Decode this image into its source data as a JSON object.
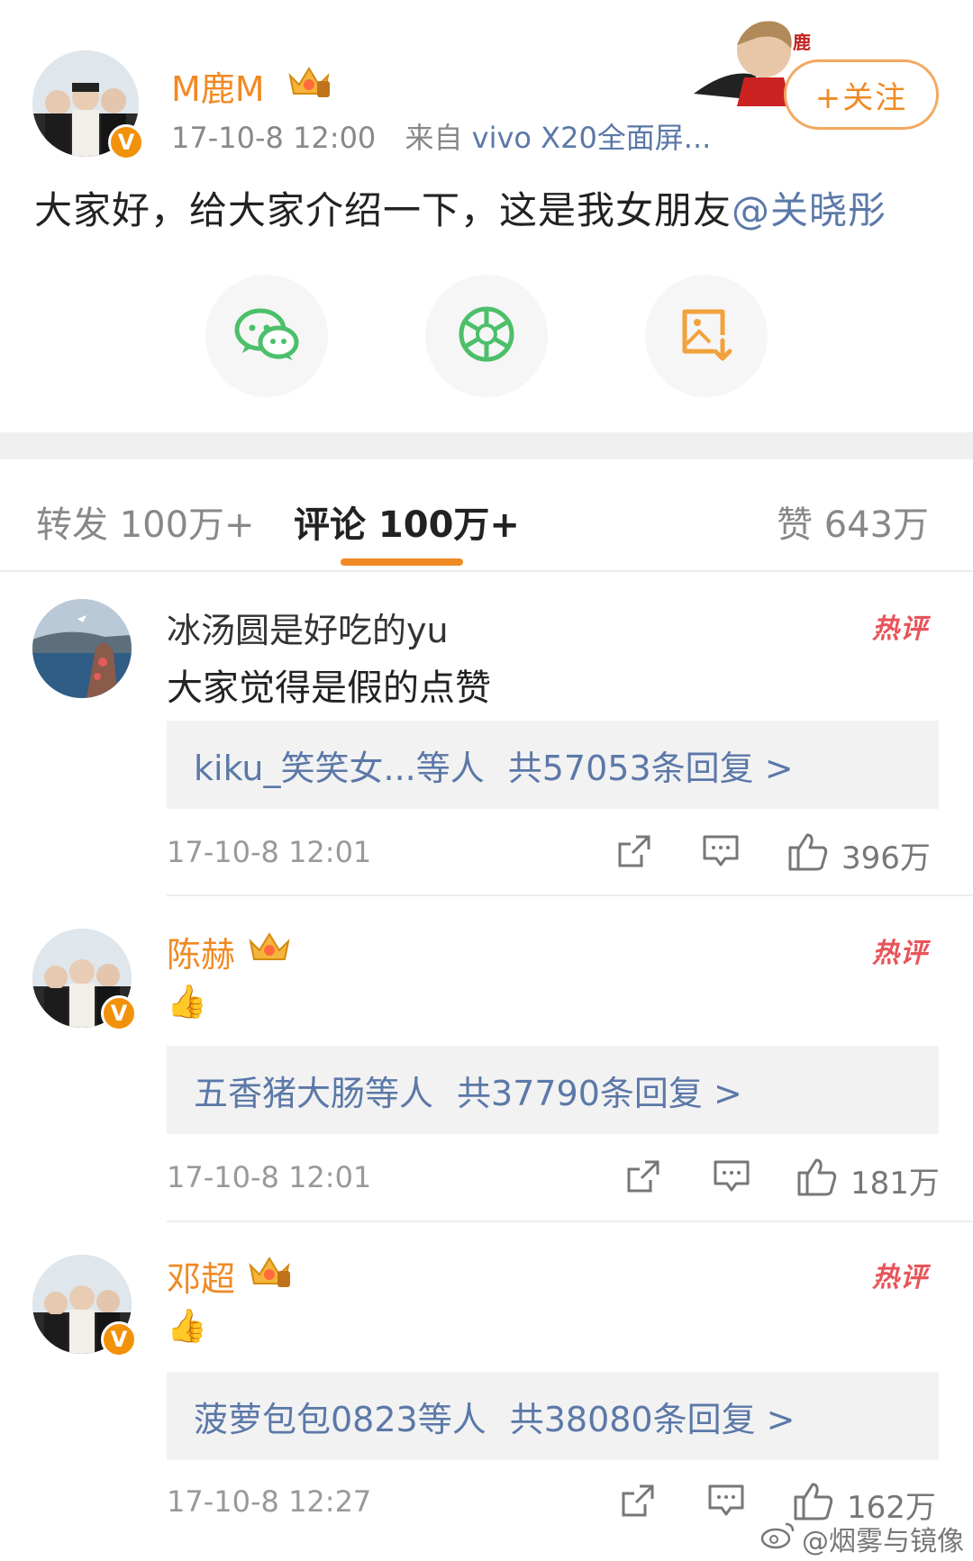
{
  "post": {
    "author_name": "M鹿M",
    "timestamp": "17-10-8 12:00",
    "source_prefix": "来自",
    "source_device": "vivo X20全面屏...",
    "follow_label": "+关注",
    "text": "大家好，给大家介绍一下，这是我女朋友",
    "mention": "@关晓彤",
    "share_icons": [
      "wechat-icon",
      "moments-icon",
      "save-image-icon"
    ]
  },
  "tabs": {
    "repost": "转发 100万+",
    "comments": "评论 100万+",
    "likes": "赞 643万"
  },
  "comments": [
    {
      "name": "冰汤圆是好吃的yu",
      "text": "大家觉得是假的点赞",
      "hot_label": "热评",
      "reply_users": "kiku_笑笑女...等人",
      "reply_count": "共57053条回复 >",
      "time": "17-10-8 12:01",
      "likes": "396万"
    },
    {
      "name": "陈赫",
      "text": "👍",
      "hot_label": "热评",
      "reply_users": "五香猪大肠等人",
      "reply_count": "共37790条回复 >",
      "time": "17-10-8 12:01",
      "likes": "181万"
    },
    {
      "name": "邓超",
      "text": "👍",
      "hot_label": "热评",
      "reply_users": "菠萝包包0823等人",
      "reply_count": "共38080条回复 >",
      "time": "17-10-8 12:27",
      "likes": "162万"
    }
  ],
  "watermark": "@烟雾与镜像",
  "colors": {
    "accent_orange": "#f08a24",
    "link_blue": "#5b78a8",
    "hot_red": "#e8545a",
    "verified_badge": "#f2910a"
  }
}
